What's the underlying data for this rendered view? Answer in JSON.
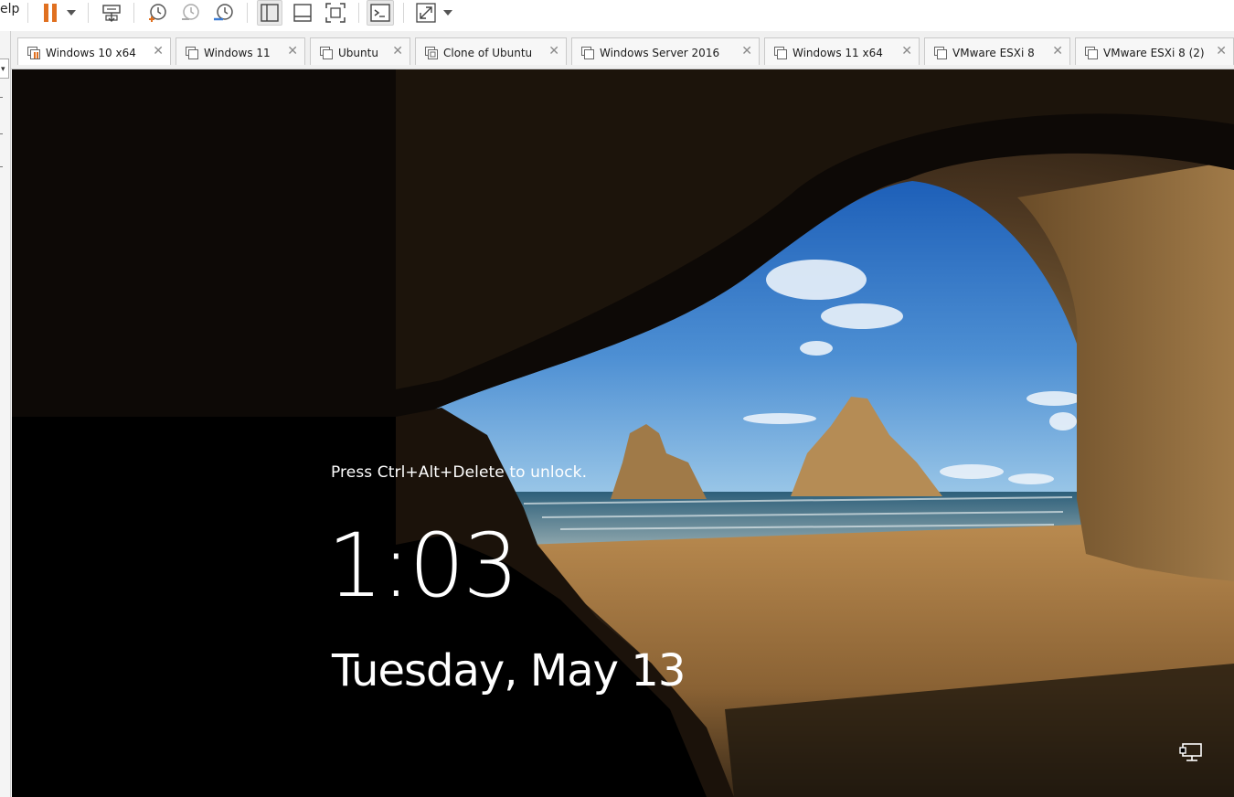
{
  "menu": {
    "help_fragment": "elp"
  },
  "toolbar": {
    "items": [
      {
        "name": "power-suspend",
        "icon": "pause-icon",
        "color": "#e07020"
      },
      {
        "name": "power-dropdown",
        "icon": "chevron-down-icon"
      },
      {
        "name": "send-ctrl-alt-del",
        "icon": "keyboard-icon"
      },
      {
        "name": "take-snapshot",
        "icon": "snapshot-take-icon"
      },
      {
        "name": "revert-snapshot",
        "icon": "snapshot-revert-icon"
      },
      {
        "name": "snapshot-manager",
        "icon": "snapshot-manager-icon"
      },
      {
        "name": "show-library",
        "icon": "library-pane-icon",
        "pressed": true
      },
      {
        "name": "show-thumbnail-bar",
        "icon": "thumbnail-bar-icon"
      },
      {
        "name": "full-screen",
        "icon": "full-screen-icon"
      },
      {
        "name": "console-view",
        "icon": "terminal-icon",
        "pressed": true
      },
      {
        "name": "stretch-guest",
        "icon": "stretch-icon"
      },
      {
        "name": "stretch-dropdown",
        "icon": "chevron-down-icon"
      }
    ]
  },
  "tabs": [
    {
      "label": "Windows 10 x64",
      "active": true,
      "running": true
    },
    {
      "label": "Windows 11",
      "active": false
    },
    {
      "label": "Ubuntu",
      "active": false
    },
    {
      "label": "Clone of Ubuntu",
      "active": false,
      "clone": true
    },
    {
      "label": "Windows Server 2016",
      "active": false
    },
    {
      "label": "Windows 11 x64",
      "active": false
    },
    {
      "label": "VMware ESXi 8",
      "active": false
    },
    {
      "label": "VMware ESXi 8 (2)",
      "active": false
    }
  ],
  "tab_close_glyph": "✕",
  "lockscreen": {
    "hint": "Press Ctrl+Alt+Delete to unlock.",
    "time": "1:03",
    "date": "Tuesday, May 13",
    "network_icon": "network-wired-icon"
  },
  "colors": {
    "accent_pause": "#e07020",
    "tab_border": "#c9c9c9",
    "lock_text": "#ffffff"
  }
}
